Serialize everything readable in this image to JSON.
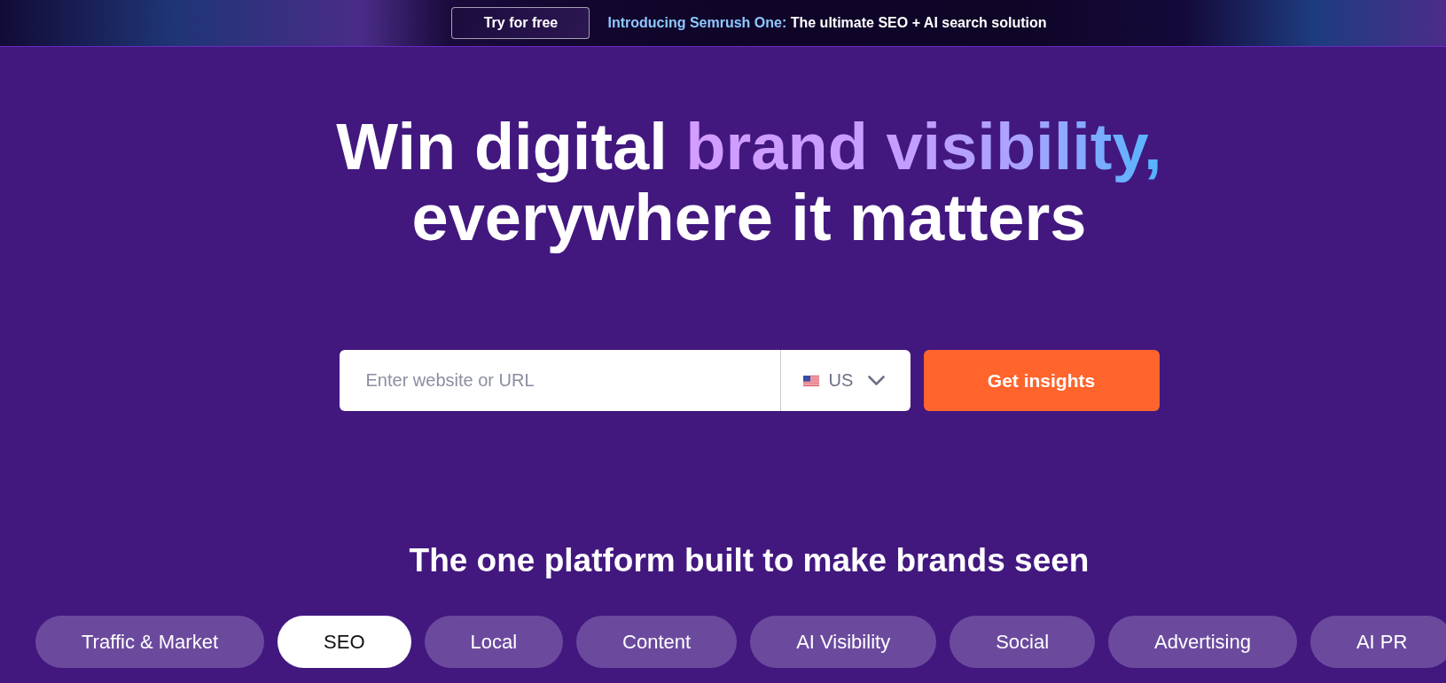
{
  "banner": {
    "button": "Try for free",
    "highlight": "Introducing Semrush One:",
    "text": "The ultimate SEO + AI search solution"
  },
  "hero": {
    "headline_start": "Win digital",
    "headline_highlight": "brand visibility,",
    "headline_end": "everywhere it matters"
  },
  "search": {
    "placeholder": "Enter website or URL",
    "country": "US",
    "button": "Get insights"
  },
  "platform": {
    "heading": "The one platform built to make brands seen",
    "tabs": [
      {
        "label": "Traffic & Market",
        "selected": false
      },
      {
        "label": "SEO",
        "selected": true
      },
      {
        "label": "Local",
        "selected": false
      },
      {
        "label": "Content",
        "selected": false
      },
      {
        "label": "AI Visibility",
        "selected": false
      },
      {
        "label": "Social",
        "selected": false
      },
      {
        "label": "Advertising",
        "selected": false
      },
      {
        "label": "AI PR",
        "selected": false
      }
    ]
  }
}
